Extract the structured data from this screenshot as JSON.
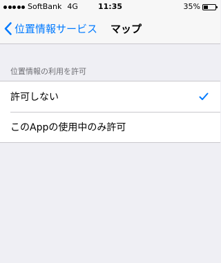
{
  "status_bar": {
    "carrier": "SoftBank",
    "network": "4G",
    "time": "11:35",
    "battery_text": "35%",
    "battery_level": 0.35
  },
  "nav": {
    "back_label": "位置情報サービス",
    "title": "マップ"
  },
  "section": {
    "header": "位置情報の利用を許可",
    "options": [
      {
        "label": "許可しない",
        "selected": true
      },
      {
        "label": "このAppの使用中のみ許可",
        "selected": false
      }
    ]
  },
  "colors": {
    "accent": "#007aff",
    "background": "#efeff4"
  }
}
